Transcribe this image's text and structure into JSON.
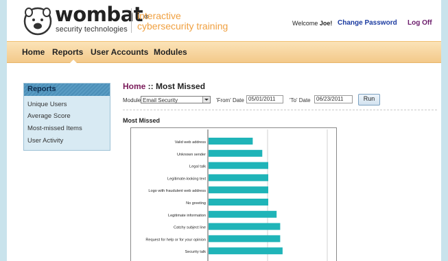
{
  "header": {
    "brand": "wombat",
    "trademark": "®",
    "sub": "security technologies",
    "tagline_1": "interactive",
    "tagline_2": "cybersecurity training",
    "welcome_prefix": "Welcome",
    "user": "Joe!",
    "change_password": "Change Password",
    "log_off": "Log Off"
  },
  "nav": {
    "items": [
      "Home",
      "Reports",
      "User Accounts",
      "Modules"
    ],
    "active": "Reports"
  },
  "sidebar": {
    "title": "Reports",
    "items": [
      "Unique Users",
      "Average Score",
      "Most-missed Items",
      "User Activity"
    ]
  },
  "breadcrumb": {
    "home": "Home",
    "separator": " :: ",
    "current": "Most Missed"
  },
  "filters": {
    "module_label": "Module",
    "module_value": "Email Security",
    "from_label": "'From' Date",
    "from_value": "05/01/2011",
    "to_label": "'To' Date",
    "to_value": "06/23/2011",
    "run_label": "Run"
  },
  "section_title": "Most Missed",
  "colors": {
    "bar": "#1fb4b8",
    "nav_bg": "#f5cf94",
    "sidebar_head": "#4c8fb8",
    "breadcrumb_home": "#7a1a5a"
  },
  "chart_data": {
    "type": "bar",
    "orientation": "horizontal",
    "categories": [
      "Valid web address",
      "Unknown sender",
      "Legal talk",
      "Legitimate-looking text",
      "Logo with fraudulent web address",
      "No greeting",
      "Legitimate information",
      "Catchy subject line",
      "Request for help or for your opinion",
      "Security talk"
    ],
    "values": [
      37,
      45,
      50,
      50,
      50,
      50,
      57,
      60,
      60,
      62
    ],
    "xlim": [
      0,
      100
    ],
    "grid": true
  }
}
